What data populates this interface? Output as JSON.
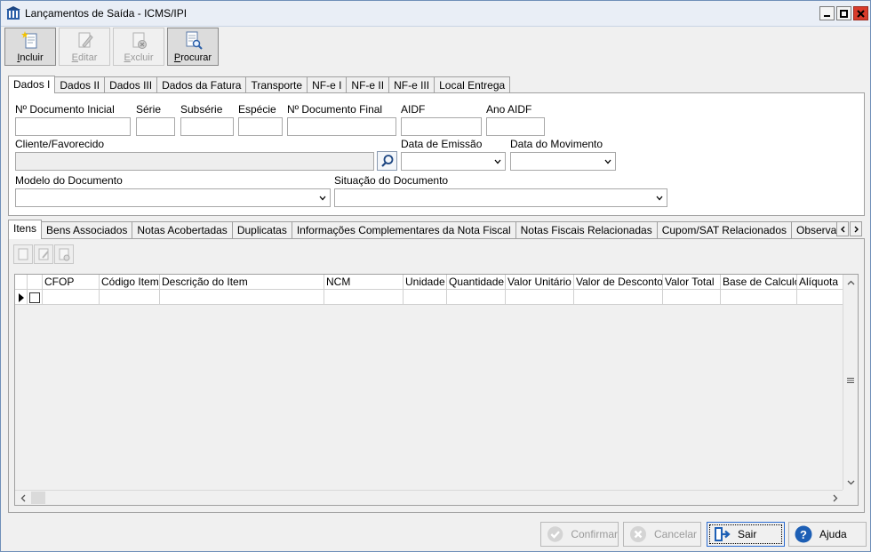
{
  "window": {
    "title": "Lançamentos de Saída - ICMS/IPI"
  },
  "toolbar": {
    "buttons": [
      {
        "label_u": "I",
        "label_rest": "ncluir",
        "enabled": true
      },
      {
        "label_u": "E",
        "label_rest": "ditar",
        "enabled": false
      },
      {
        "label_u": "E",
        "label_rest": "xcluir",
        "enabled": false
      },
      {
        "label_u": "P",
        "label_rest": "rocurar",
        "enabled": true
      }
    ]
  },
  "tabs_top": [
    "Dados I",
    "Dados II",
    "Dados III",
    "Dados da Fatura",
    "Transporte",
    "NF-e I",
    "NF-e II",
    "NF-e III",
    "Local Entrega"
  ],
  "form": {
    "num_doc_inicial": "Nº Documento Inicial",
    "serie": "Série",
    "subserie": "Subsérie",
    "especie": "Espécie",
    "num_doc_final": "Nº Documento Final",
    "aidf": "AIDF",
    "ano_aidf": "Ano AIDF",
    "cliente": "Cliente/Favorecido",
    "data_emissao": "Data de Emissão",
    "data_movimento": "Data do Movimento",
    "modelo_documento": "Modelo do Documento",
    "situacao_documento": "Situação do Documento"
  },
  "tabs_bottom": [
    "Itens",
    "Bens Associados",
    "Notas Acobertadas",
    "Duplicatas",
    "Informações Complementares da Nota Fiscal",
    "Notas Fiscais Relacionadas",
    "Cupom/SAT Relacionados",
    "Observação do"
  ],
  "grid": {
    "columns": [
      "CFOP",
      "Código Item",
      "Descrição do Item",
      "NCM",
      "Unidade",
      "Quantidade",
      "Valor Unitário",
      "Valor de Desconto",
      "Valor Total",
      "Base de Calculo",
      "Alíquota"
    ]
  },
  "footer": {
    "confirmar": {
      "u": "",
      "pre": "",
      "text_u": "",
      "label": "Confirmar"
    },
    "cancelar": {
      "label": "Cancelar"
    },
    "sair": {
      "label": "Sair"
    },
    "ajuda": {
      "label": "Ajuda"
    }
  },
  "colors": {
    "title_bg": "#e9eef6",
    "window_border": "#6f8fb8",
    "close_red": "#d93b2b",
    "focus_blue": "#2a6bd1"
  }
}
